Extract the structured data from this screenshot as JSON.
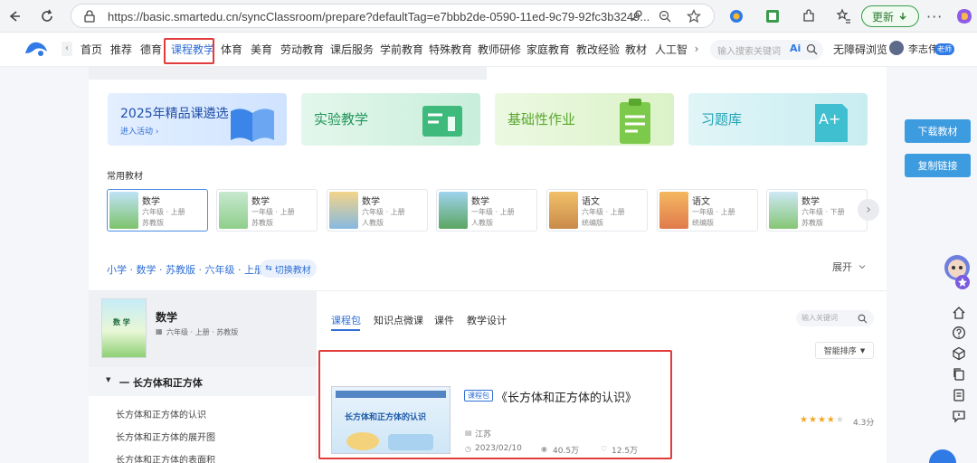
{
  "browser": {
    "url": "https://basic.smartedu.cn/syncClassroom/prepare?defaultTag=e7bbb2de-0590-11ed-9c79-92fc3b3249...",
    "update_label": "更新"
  },
  "nav": {
    "items": [
      "首页",
      "推荐",
      "德育",
      "课程教学",
      "体育",
      "美育",
      "劳动教育",
      "课后服务",
      "学前教育",
      "特殊教育",
      "教师研修",
      "家庭教育",
      "教改经验",
      "教材",
      "人工智"
    ],
    "search_placeholder": "输入搜索关键词",
    "barrier_free": "无障碍浏览",
    "user_name": "李志伟",
    "user_badge": "老师"
  },
  "banners": [
    {
      "title": "2025年精品课遴选",
      "subtitle": "进入活动 ›"
    },
    {
      "title": "实验教学"
    },
    {
      "title": "基础性作业"
    },
    {
      "title": "习题库"
    }
  ],
  "common_books_label": "常用教材",
  "books": [
    {
      "name": "数学",
      "grade": "六年级 · 上册",
      "publisher": "苏教版"
    },
    {
      "name": "数学",
      "grade": "一年级 · 上册",
      "publisher": "苏教版"
    },
    {
      "name": "数学",
      "grade": "六年级 · 上册",
      "publisher": "人教版"
    },
    {
      "name": "数学",
      "grade": "一年级 · 上册",
      "publisher": "人教版"
    },
    {
      "name": "语文",
      "grade": "六年级 · 上册",
      "publisher": "统编版"
    },
    {
      "name": "语文",
      "grade": "一年级 · 上册",
      "publisher": "统编版"
    },
    {
      "name": "数学",
      "grade": "六年级 · 下册",
      "publisher": "苏教版"
    }
  ],
  "breadcrumb": "小学 · 数学 · 苏教版 · 六年级 · 上册",
  "switch_label": "切换教材",
  "expand_label": "展开",
  "left_book": {
    "title": "数学",
    "meta": "六年级 · 上册 · 苏教版",
    "cover_text": "数 学"
  },
  "tree": {
    "section": "一 长方体和正方体",
    "items": [
      "长方体和正方体的认识",
      "长方体和正方体的展开图",
      "长方体和正方体的表面积"
    ]
  },
  "tabs": [
    "课程包",
    "知识点微课",
    "课件",
    "教学设计"
  ],
  "content_search_placeholder": "输入关键词",
  "sort_label": "智能排序",
  "course": {
    "badge": "课程包",
    "title": "《长方体和正方体的认识》",
    "thumb_title": "长方体和正方体的认识",
    "region": "江苏",
    "date": "2023/02/10",
    "views": "40.5万",
    "likes": "12.5万",
    "rating": "4.3分",
    "stars": 4.3
  },
  "side_buttons": {
    "download": "下载教材",
    "copy_link": "复制链接"
  },
  "colors": {
    "accent": "#3d7fd9",
    "highlight": "#e23b3b",
    "float_btn": "#3d9be0",
    "star": "#f5a623"
  }
}
